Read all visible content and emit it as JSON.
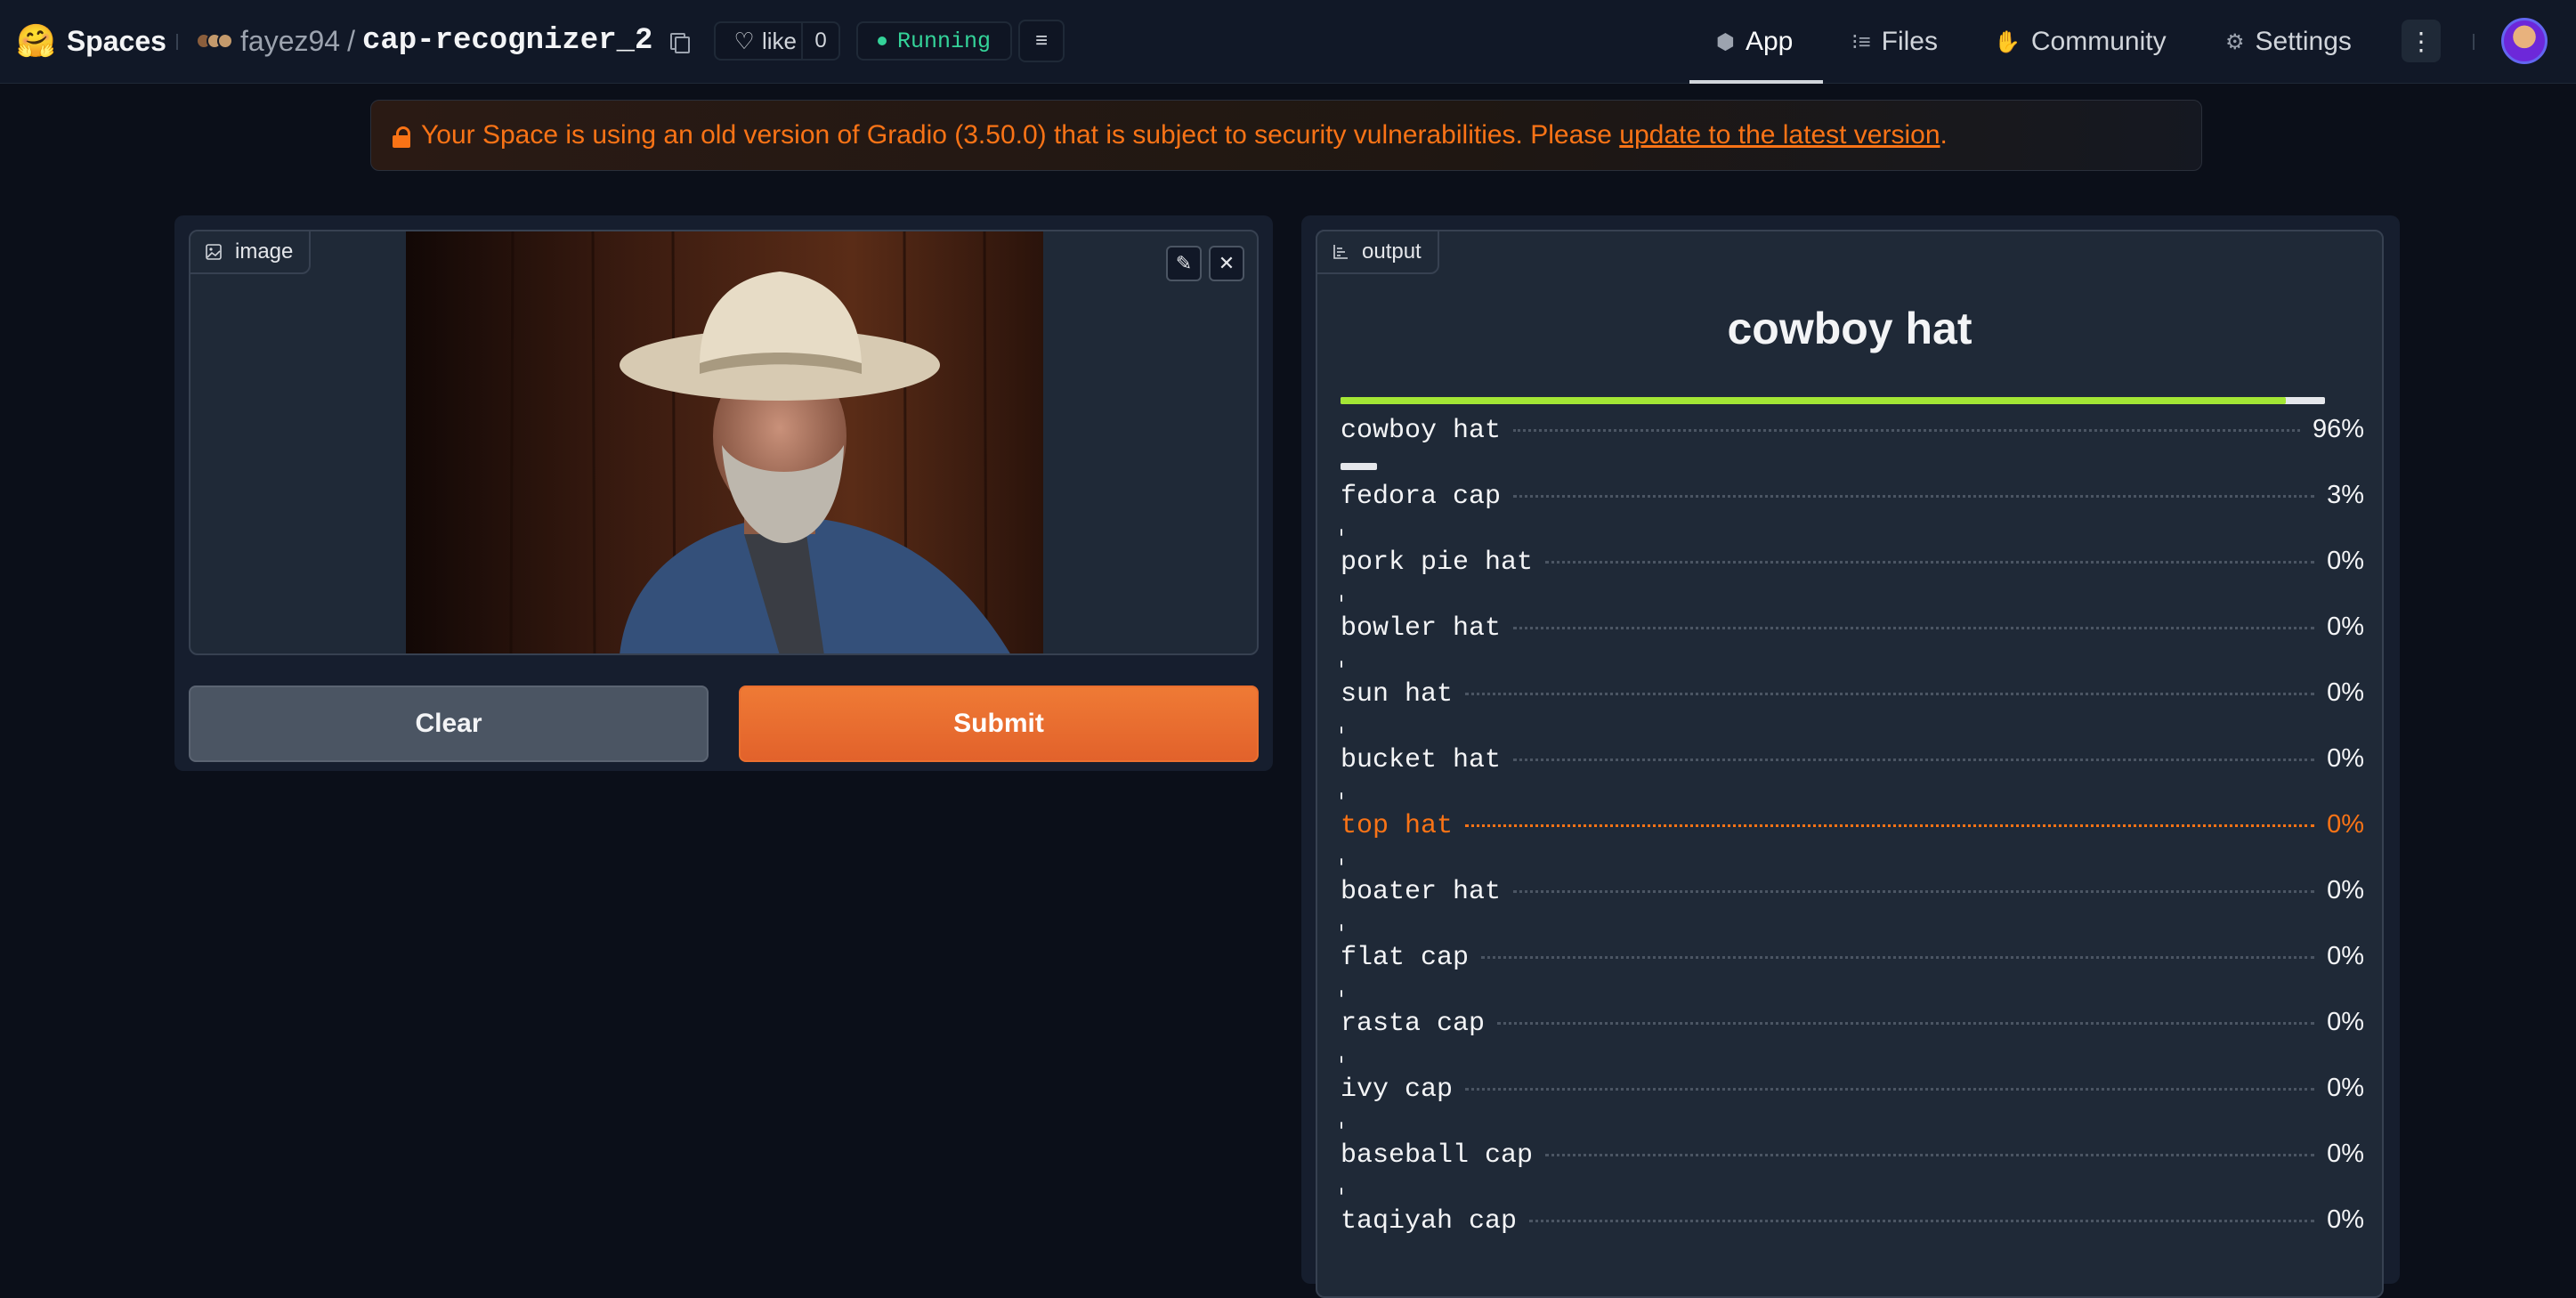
{
  "header": {
    "brand_emoji": "🤗",
    "brand_name": "Spaces",
    "owner": "fayez94",
    "slash": "/",
    "space_name": "cap-recognizer_2",
    "like_label": "like",
    "like_count": "0",
    "status": "Running",
    "nav": {
      "app": "App",
      "files": "Files",
      "community": "Community",
      "settings": "Settings"
    }
  },
  "banner": {
    "text_before": "Your Space is using an old version of Gradio (3.50.0) that is subject to security vulnerabilities. Please ",
    "link_text": "update to the latest version",
    "text_after": "."
  },
  "input": {
    "label": "image",
    "clear_label": "Clear",
    "submit_label": "Submit"
  },
  "output": {
    "label": "output",
    "top_label": "cowboy hat",
    "confidences": [
      {
        "label": "cowboy hat",
        "pct": "96%",
        "value": 0.96
      },
      {
        "label": "fedora cap",
        "pct": "3%",
        "value": 0.03
      },
      {
        "label": "pork pie hat",
        "pct": "0%",
        "value": 0.0
      },
      {
        "label": "bowler hat",
        "pct": "0%",
        "value": 0.0
      },
      {
        "label": "sun hat",
        "pct": "0%",
        "value": 0.0
      },
      {
        "label": "bucket hat",
        "pct": "0%",
        "value": 0.0
      },
      {
        "label": "top hat",
        "pct": "0%",
        "value": 0.0
      },
      {
        "label": "boater hat",
        "pct": "0%",
        "value": 0.0
      },
      {
        "label": "flat cap",
        "pct": "0%",
        "value": 0.0
      },
      {
        "label": "rasta cap",
        "pct": "0%",
        "value": 0.0
      },
      {
        "label": "ivy cap",
        "pct": "0%",
        "value": 0.0
      },
      {
        "label": "baseball cap",
        "pct": "0%",
        "value": 0.0
      },
      {
        "label": "taqiyah cap",
        "pct": "0%",
        "value": 0.0
      }
    ]
  },
  "colors": {
    "accent": "#f97316",
    "bar_fill": "#a3e635",
    "status": "#34d399"
  }
}
